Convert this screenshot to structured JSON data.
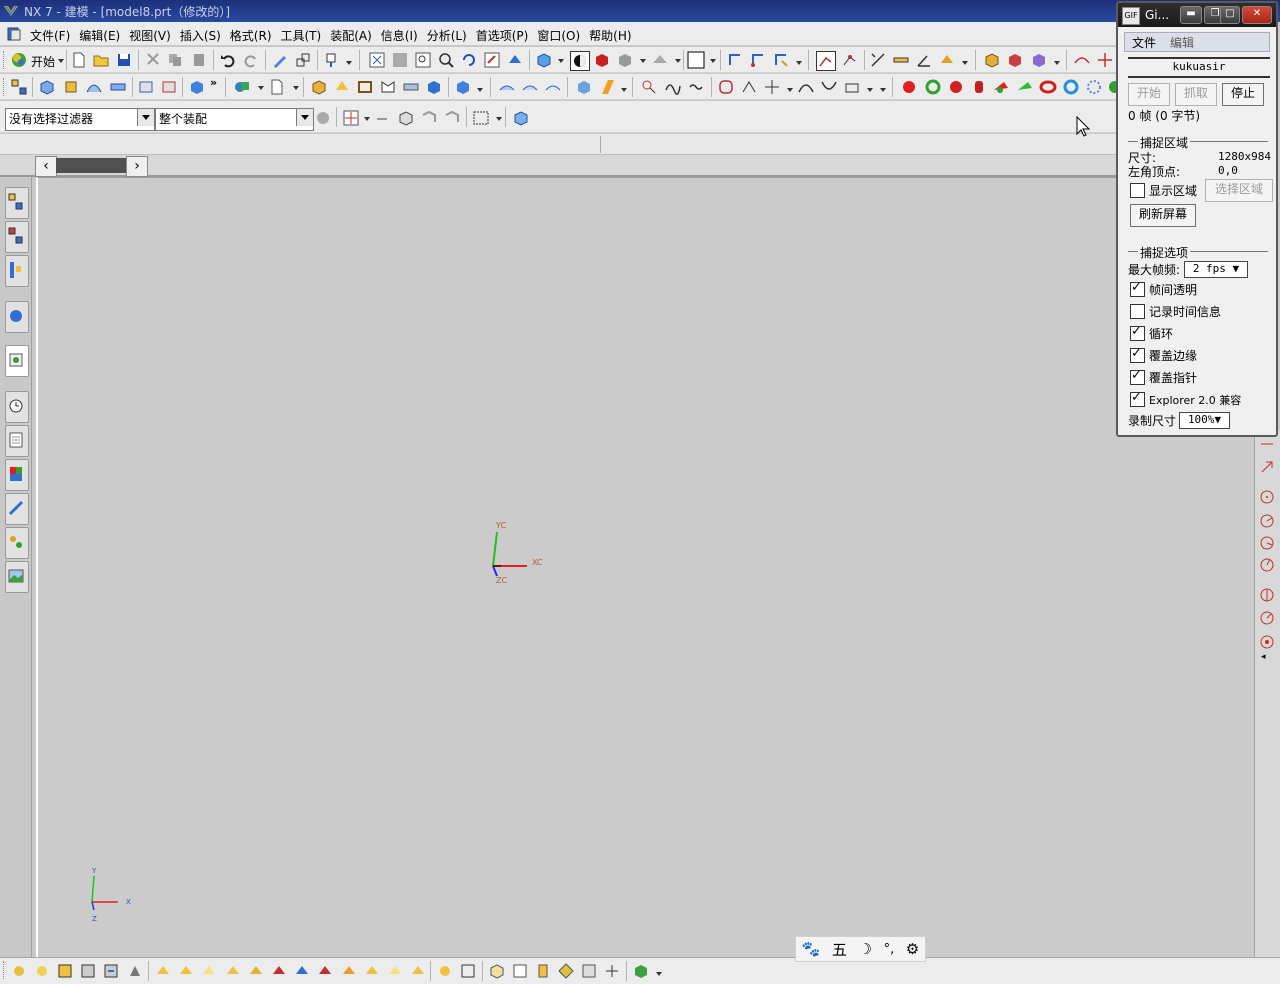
{
  "window": {
    "title": "NX 7 - 建模 - [model8.prt（修改的）]"
  },
  "menu": {
    "items": [
      "文件(F)",
      "编辑(E)",
      "视图(V)",
      "插入(S)",
      "格式(R)",
      "工具(T)",
      "装配(A)",
      "信息(I)",
      "分析(L)",
      "首选项(P)",
      "窗口(O)",
      "帮助(H)"
    ]
  },
  "toolbar": {
    "start_label": "开始"
  },
  "selection": {
    "filter_value": "没有选择过滤器",
    "scope_value": "整个装配"
  },
  "viewport": {
    "wcs_labels": {
      "x": "XC",
      "y": "YC",
      "z": "ZC"
    },
    "abs_labels": {
      "x": "X",
      "y": "Y",
      "z": "Z"
    },
    "colors": {
      "x_axis": "#e02020",
      "y_axis": "#20c020",
      "z_axis": "#2030e0"
    }
  },
  "ime": {
    "items": [
      "paw-icon",
      "五",
      "moon-icon",
      "dots-icon",
      "gear-icon"
    ],
    "label_five": "五"
  },
  "capture": {
    "title": "Gi...",
    "menu": [
      "文件",
      "编辑"
    ],
    "username": "kukuasir",
    "buttons": {
      "start": "开始",
      "grab": "抓取",
      "stop": "停止"
    },
    "frame_info": "0 帧 (0 字节)",
    "area_section": "捕捉区域",
    "size_label": "尺寸:",
    "size_value": "1280x984",
    "corner_label": "左角顶点:",
    "corner_value": "0,0",
    "show_area_label": "显示区域",
    "show_area_checked": false,
    "select_area_button": "选择区域",
    "refresh_button": "刷新屏幕",
    "options_section": "捕捉选项",
    "fps_label": "最大帧频:",
    "fps_value": "2 fps",
    "options": [
      {
        "label": "帧间透明",
        "checked": true
      },
      {
        "label": "记录时间信息",
        "checked": false
      },
      {
        "label": "循环",
        "checked": true
      },
      {
        "label": "覆盖边缘",
        "checked": true
      },
      {
        "label": "覆盖指针",
        "checked": true
      },
      {
        "label": "Explorer 2.0 兼容",
        "checked": true
      }
    ],
    "record_size_label": "录制尺寸",
    "record_size_value": "100%"
  }
}
